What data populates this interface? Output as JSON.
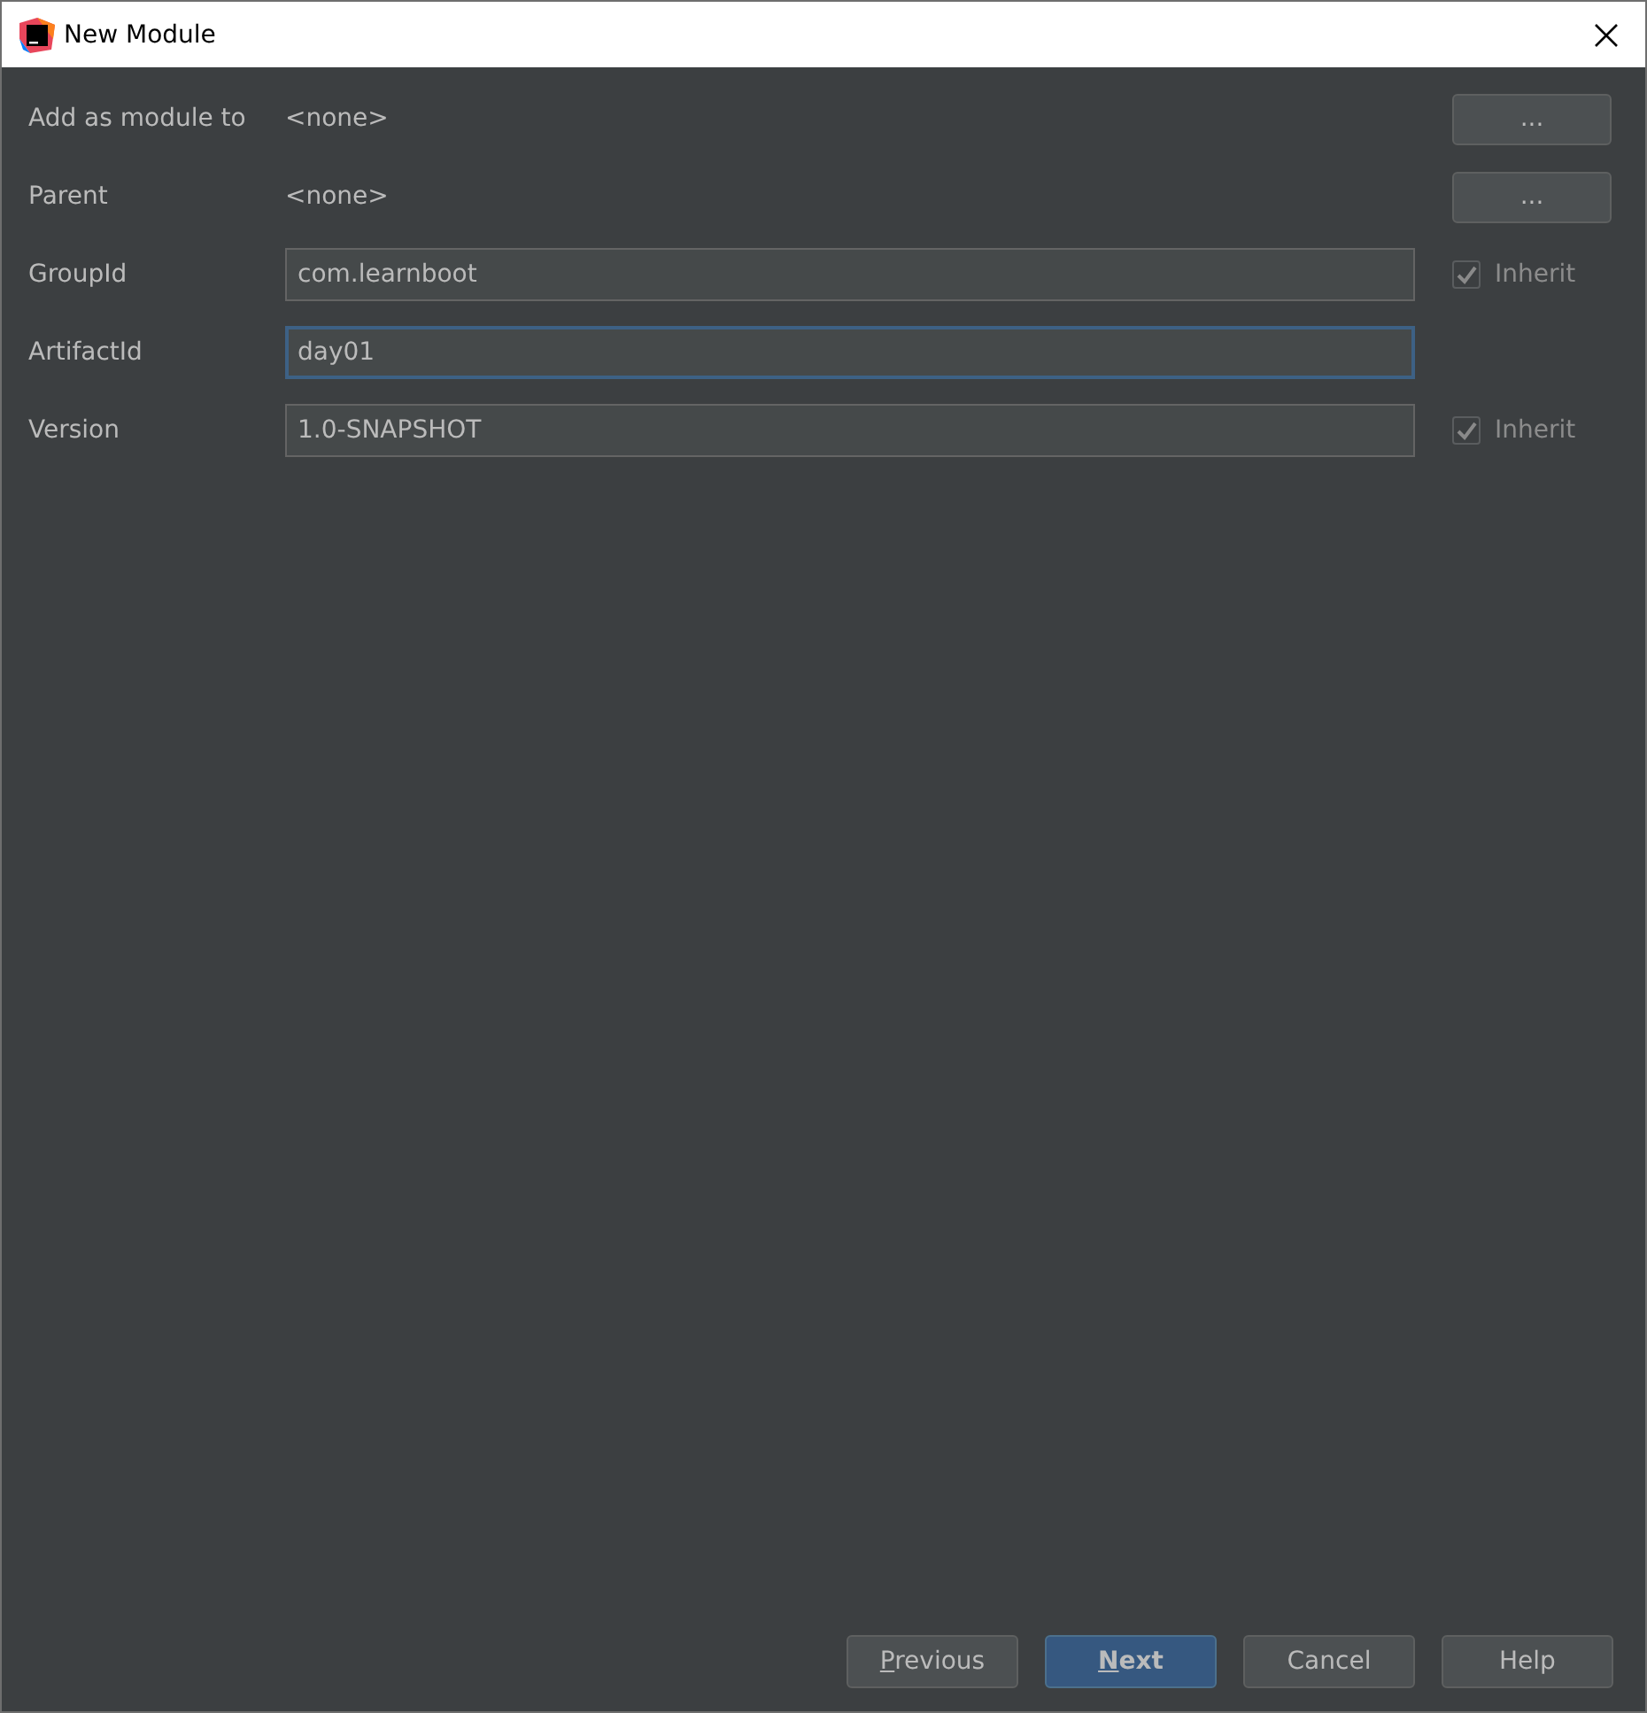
{
  "window": {
    "title": "New Module"
  },
  "rows": [
    {
      "kind": "text",
      "label": "Add as module to",
      "value": "<none>",
      "button": "..."
    },
    {
      "kind": "text",
      "label": "Parent",
      "value": "<none>",
      "button": "..."
    },
    {
      "kind": "field",
      "label": "GroupId",
      "value": "com.learnboot",
      "focused": false,
      "inherit": {
        "label": "Inherit",
        "checked": true,
        "disabled": true
      }
    },
    {
      "kind": "field",
      "label": "ArtifactId",
      "value": "day01",
      "focused": true
    },
    {
      "kind": "field",
      "label": "Version",
      "value": "1.0-SNAPSHOT",
      "focused": false,
      "inherit": {
        "label": "Inherit",
        "checked": true,
        "disabled": true
      }
    }
  ],
  "buttons": [
    {
      "mnemonic": "P",
      "rest": "revious",
      "default": false
    },
    {
      "mnemonic": "N",
      "rest": "ext",
      "default": true
    },
    {
      "rest": "Cancel",
      "default": false
    },
    {
      "rest": "Help",
      "default": false
    }
  ]
}
